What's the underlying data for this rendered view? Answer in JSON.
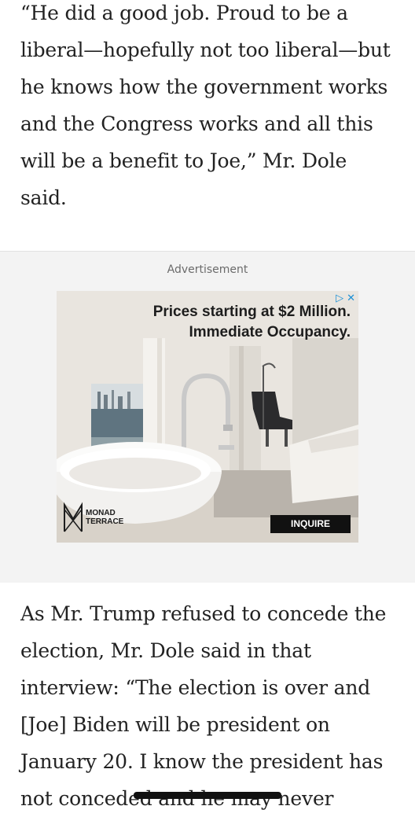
{
  "article": {
    "paragraph_top": "“He did a good job. Proud to be a liberal—hopefully not too liberal—but he knows how the government works and the Congress works and all this will be a benefit to Joe,” Mr. Dole said.",
    "paragraph_bottom": "As Mr. Trump refused to concede the election, Mr. Dole said in that interview: “The election is over and [Joe] Biden will be president on January 20. I know the president has not conceded and he may never"
  },
  "advertisement": {
    "label": "Advertisement",
    "headline_line1": "Prices starting at $2 Million.",
    "headline_line2": "Immediate Occupancy.",
    "brand_name": "MONAD\nTERRACE",
    "cta_label": "INQUIRE",
    "adchoices_icon": "adchoices-icon",
    "close_icon": "close-icon",
    "adchoices_glyph": "▷",
    "close_glyph": "✕"
  },
  "colors": {
    "ad_background": "#f3f3f3",
    "adchoices": "#1a8fd6",
    "cta_background": "#111111"
  }
}
